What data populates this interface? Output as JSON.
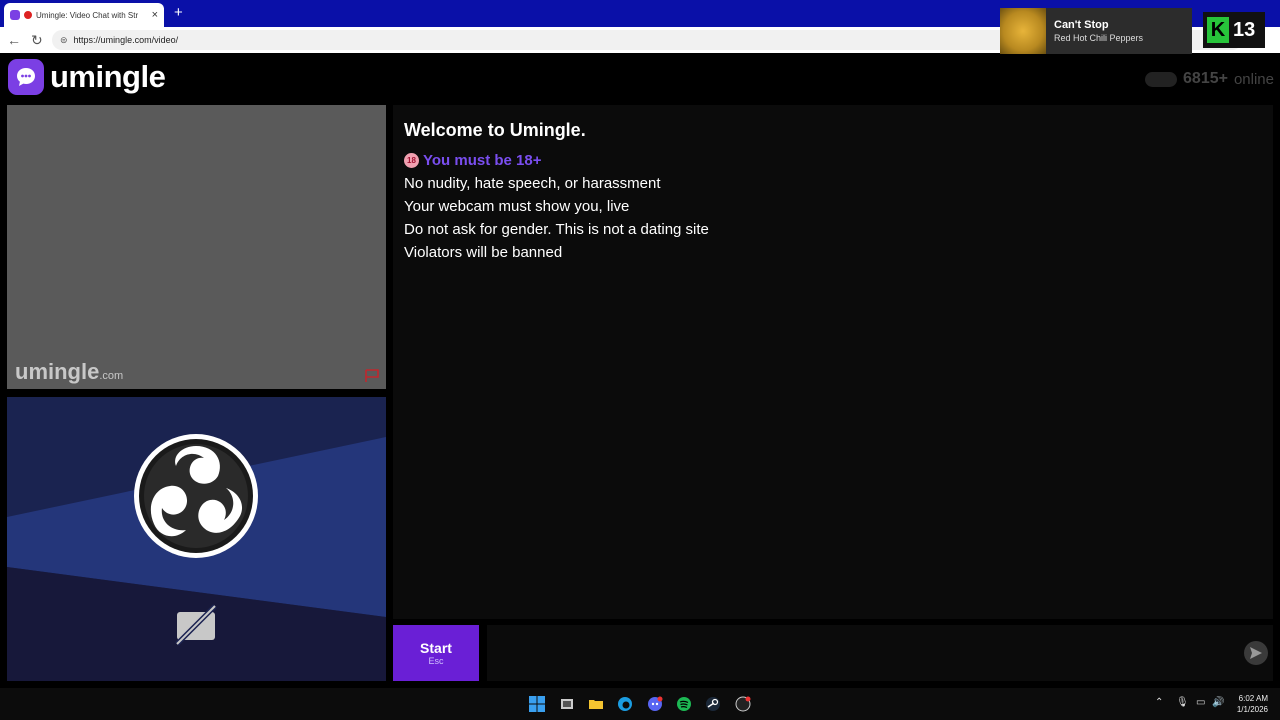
{
  "browser": {
    "tab_title": "Umingle: Video Chat with Str",
    "new_tab_symbol": "+",
    "url": "https://umingle.com/video/"
  },
  "now_playing": {
    "song": "Can't Stop",
    "artist": "Red Hot Chili Peppers"
  },
  "overlay_badge": {
    "letter": "K",
    "number": "13"
  },
  "site": {
    "logo_text": "umingle",
    "online_count": "6815+",
    "online_label": "online"
  },
  "remote_video": {
    "watermark": "umingle",
    "watermark_suffix": ".com"
  },
  "chat": {
    "welcome_title": "Welcome to Umingle.",
    "age_badge": "18",
    "age_notice": "You must be 18+",
    "rules": [
      "No nudity, hate speech, or harassment",
      "Your webcam must show you, live",
      "Do not ask for gender. This is not a dating site",
      "Violators will be banned"
    ]
  },
  "controls": {
    "start_label": "Start",
    "start_shortcut": "Esc",
    "message_placeholder": ""
  },
  "taskbar": {
    "time": "6:02 AM",
    "date": "1/1/2026"
  },
  "colors": {
    "brand_purple": "#7b3fe4",
    "start_button": "#6a1fd6",
    "age_notice": "#7a4ef0",
    "tabbar_blue": "#0a10a8"
  },
  "icons": {
    "back": "back-arrow-icon",
    "reload": "reload-icon",
    "report": "flag-icon",
    "camera_off": "camera-off-icon",
    "send": "send-icon"
  }
}
